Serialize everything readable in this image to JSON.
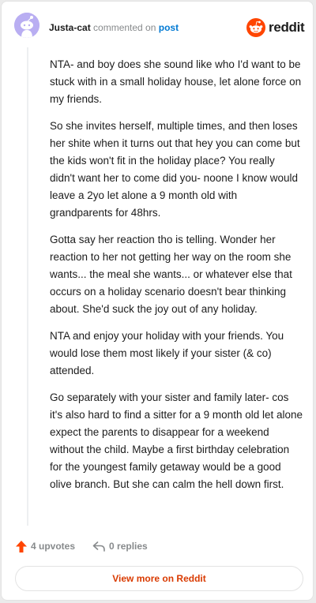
{
  "header": {
    "author": "Justa-cat",
    "action_text": "commented on",
    "post_link": "post",
    "logo_text": "reddit"
  },
  "comment": {
    "paragraphs": [
      "NTA- and boy does she sound like who I'd want to be stuck with in a small holiday house, let alone force on my friends.",
      "So she invites herself, multiple times, and then loses her shite when it turns out that hey you can come but the kids won't fit in the holiday place? You really didn't want her to come did you- noone I know would leave a 2yo let alone a 9 month old with grandparents for 48hrs.",
      "Gotta say her reaction tho is telling. Wonder her reaction to her not getting her way on the room she wants... the meal she wants... or whatever else that occurs on a holiday scenario doesn't bear thinking about. She'd suck the joy out of any holiday.",
      "NTA and enjoy your holiday with your friends. You would lose them most likely if your sister (& co) attended.",
      "Go separately with your sister and family later- cos it's also hard to find a sitter for a 9 month old let alone expect the parents to disappear for a weekend without the child. Maybe a first birthday celebration for the youngest family getaway would be a good olive branch. But she can calm the hell down first."
    ]
  },
  "actions": {
    "upvotes": "4 upvotes",
    "replies": "0 replies"
  },
  "footer": {
    "view_more": "View more on Reddit"
  },
  "colors": {
    "brand": "#ff4500",
    "link": "#0079d3",
    "view_more_text": "#d93a00",
    "avatar_bg": "#b9aef2",
    "muted_text": "#878a8c"
  },
  "icons": {
    "avatar": "snoo-avatar-icon",
    "logo": "reddit-snoo-icon",
    "upvote": "upvote-arrow-icon",
    "reply": "reply-arrow-icon"
  }
}
